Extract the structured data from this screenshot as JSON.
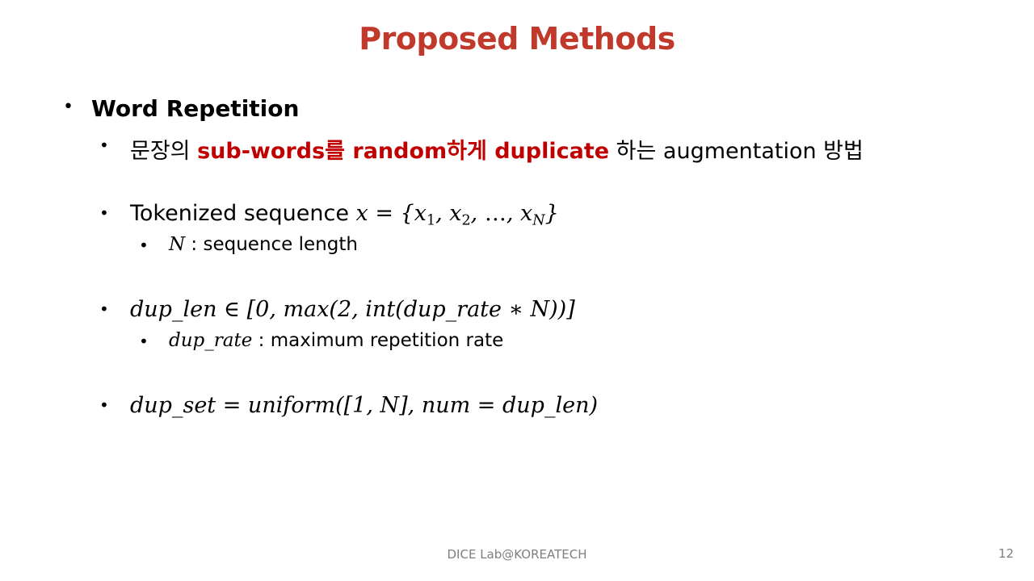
{
  "title": "Proposed Methods",
  "bullets": {
    "word_repetition": "Word Repetition",
    "desc_prefix": "문장의 ",
    "desc_highlight": "sub-words를 random하게 duplicate",
    "desc_suffix": " 하는 augmentation 방법",
    "tokenized_prefix": "Tokenized sequence ",
    "tokenized_math": "x = {x",
    "sub1": "1",
    "sub2": "2",
    "subN": "N",
    "n_symbol": "N",
    "n_desc": " : sequence length",
    "dup_len_formula": "dup_len ∈ [0, max(2, int(dup_rate ∗ N))]",
    "dup_rate_symbol": "dup_rate",
    "dup_rate_desc": " : maximum repetition rate",
    "dup_set_formula": "dup_set = uniform([1, N], num = dup_len)"
  },
  "footer": "DICE Lab@KOREATECH",
  "page_number": "12"
}
